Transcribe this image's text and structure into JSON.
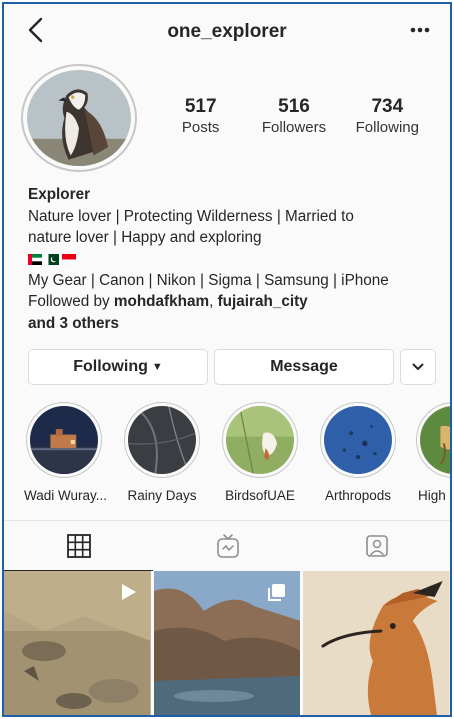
{
  "header": {
    "username": "one_explorer",
    "back_icon": "chevron-left-icon",
    "more_icon": "more-horizontal-icon"
  },
  "profile": {
    "name": "Explorer",
    "bio_line1": "Nature lover | Protecting Wilderness | Married to",
    "bio_line2": "nature lover | Happy and exploring",
    "flags": [
      "uae-flag",
      "pakistan-flag",
      "indonesia-flag"
    ],
    "gear_line": "My Gear | Canon | Nikon | Sigma | Samsung | iPhone",
    "followed_by_prefix": "Followed by ",
    "followed_by_user1": "mohdafkham",
    "followed_by_sep": ", ",
    "followed_by_user2": "fujairah_city",
    "followed_by_others": "and 3 others"
  },
  "stats": {
    "posts_count": "517",
    "posts_label": "Posts",
    "followers_count": "516",
    "followers_label": "Followers",
    "following_count": "734",
    "following_label": "Following"
  },
  "actions": {
    "following_label": "Following",
    "message_label": "Message",
    "more_icon": "chevron-down-icon"
  },
  "highlights": [
    {
      "label": "Wadi Wuray..."
    },
    {
      "label": "Rainy Days"
    },
    {
      "label": "BirdsofUAE"
    },
    {
      "label": "Arthropods"
    },
    {
      "label": "High"
    }
  ],
  "tabs": [
    {
      "icon": "grid-icon",
      "active": true
    },
    {
      "icon": "igtv-icon",
      "active": false
    },
    {
      "icon": "tagged-icon",
      "active": false
    }
  ],
  "posts": [
    {
      "badge": "video-icon"
    },
    {
      "badge": "carousel-icon"
    },
    {
      "badge": ""
    }
  ],
  "colors": {
    "border_accent": "#1f5fa8",
    "text": "#262626",
    "divider": "#dbdbdb"
  }
}
